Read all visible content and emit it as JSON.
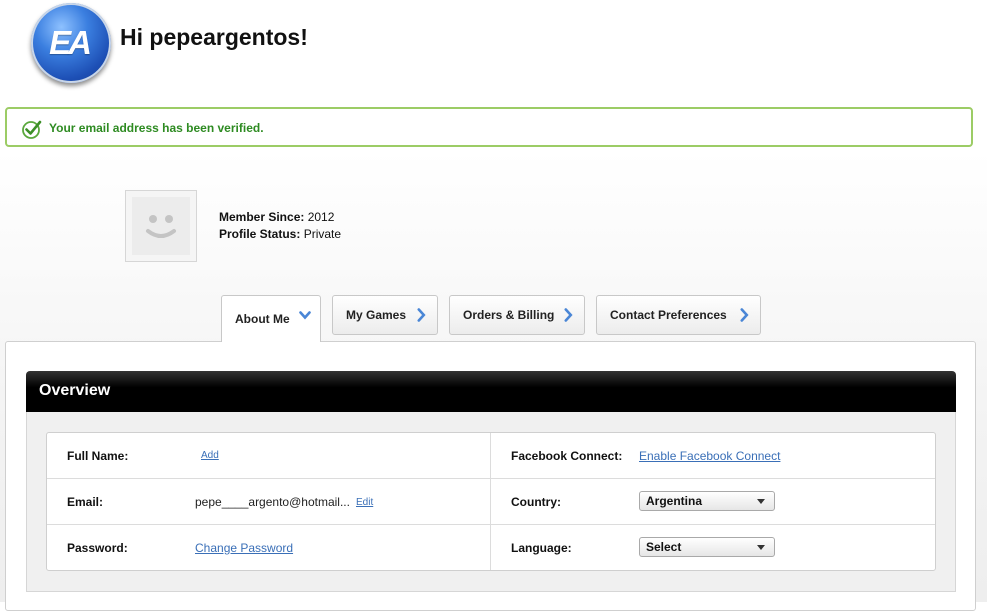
{
  "header": {
    "logo_text": "EA",
    "greeting": "Hi pepeargentos!"
  },
  "banner": {
    "message": "Your email address has been verified.",
    "color": "#2e8b22",
    "border_color": "#9ccc65",
    "icon": "check-circle-icon"
  },
  "profile": {
    "avatar_icon": "smiley-placeholder-icon",
    "member_since_label": "Member Since:",
    "member_since_value": "2012",
    "status_label": "Profile Status:",
    "status_value": "Private"
  },
  "tabs": [
    {
      "label": "About Me",
      "active": true,
      "icon": "chevron-down-icon"
    },
    {
      "label": "My Games",
      "active": false,
      "icon": "chevron-right-icon"
    },
    {
      "label": "Orders & Billing",
      "active": false,
      "icon": "chevron-right-icon"
    },
    {
      "label": "Contact Preferences",
      "active": false,
      "icon": "chevron-right-icon"
    }
  ],
  "overview": {
    "title": "Overview",
    "full_name_label": "Full Name:",
    "full_name_link": "Add",
    "email_label": "Email:",
    "email_value": "pepe____argento@hotmail...",
    "email_edit": "Edit",
    "password_label": "Password:",
    "password_link": "Change Password",
    "facebook_label": "Facebook Connect:",
    "facebook_link": "Enable Facebook Connect",
    "country_label": "Country:",
    "country_value": "Argentina",
    "language_label": "Language:",
    "language_value": "Select"
  },
  "colors": {
    "link": "#3a6fb7",
    "chevron": "#4a86d6",
    "header_bar": "#000000"
  }
}
